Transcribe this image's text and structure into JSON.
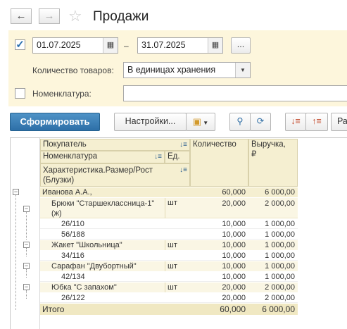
{
  "window": {
    "title": "Продажи",
    "back_glyph": "←",
    "forward_glyph": "→",
    "favorite_glyph": "☆"
  },
  "period": {
    "enabled": true,
    "start": "01.07.2025",
    "separator": "–",
    "end": "31.07.2025",
    "more_label": "..."
  },
  "quantity": {
    "label": "Количество товаров:",
    "value": "В единицах хранения"
  },
  "nomenclature": {
    "enabled": false,
    "label": "Номенклатура:",
    "value": ""
  },
  "toolbar": {
    "generate_label": "Сформировать",
    "settings_label": "Настройки...",
    "cut_label": "Ра"
  },
  "header": {
    "buyer": "Покупатель",
    "nomenclature": "Номенклатура",
    "unit": "Ед.",
    "characteristic_line1": "Характеристика.Размер/Рост",
    "characteristic_line2": "(Блузки)",
    "quantity": "Количество",
    "revenue_line1": "Выручка,",
    "revenue_line2": "₽"
  },
  "rows": [
    {
      "level": 0,
      "name": "Иванова А.А.,",
      "unit": "",
      "qty": "60,000",
      "rev": "6 000,00"
    },
    {
      "level": 1,
      "name": "Брюки \"Старшеклассница-1\"",
      "name2": "(ж)",
      "unit": "шт",
      "qty": "20,000",
      "rev": "2 000,00"
    },
    {
      "level": 2,
      "name": "26/110",
      "unit": "",
      "qty": "10,000",
      "rev": "1 000,00"
    },
    {
      "level": 2,
      "name": "56/188",
      "unit": "",
      "qty": "10,000",
      "rev": "1 000,00"
    },
    {
      "level": 1,
      "name": "Жакет \"Школьница\"",
      "unit": "шт",
      "qty": "10,000",
      "rev": "1 000,00"
    },
    {
      "level": 2,
      "name": "34/116",
      "unit": "",
      "qty": "10,000",
      "rev": "1 000,00"
    },
    {
      "level": 1,
      "name": "Сарафан \"Двубортный\"",
      "unit": "шт",
      "qty": "10,000",
      "rev": "1 000,00"
    },
    {
      "level": 2,
      "name": "42/134",
      "unit": "",
      "qty": "10,000",
      "rev": "1 000,00"
    },
    {
      "level": 1,
      "name": "Юбка \"С запахом\"",
      "unit": "шт",
      "qty": "20,000",
      "rev": "2 000,00"
    },
    {
      "level": 2,
      "name": "26/122",
      "unit": "",
      "qty": "20,000",
      "rev": "2 000,00"
    }
  ],
  "total": {
    "label": "Итого",
    "qty": "60,000",
    "rev": "6 000,00"
  }
}
